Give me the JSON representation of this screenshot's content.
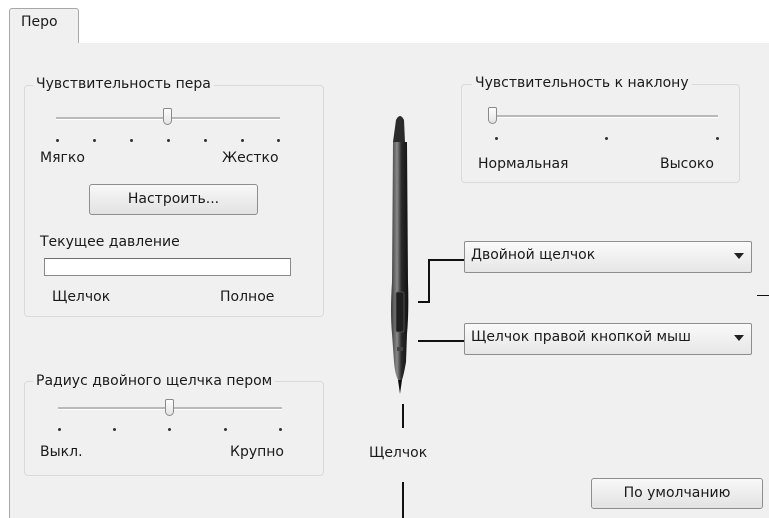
{
  "tab": {
    "label": "Перо"
  },
  "pen_sensitivity": {
    "title": "Чувствительность пера",
    "level": 0.5,
    "min_label": "Мягко",
    "max_label": "Жестко",
    "customize_button": "Настроить...",
    "pressure_title": "Текущее давление",
    "pressure_min_label": "Щелчок",
    "pressure_max_label": "Полное"
  },
  "double_click_radius": {
    "title": "Радиус двойного щелчка пером",
    "level": 0.5,
    "min_label": "Выкл.",
    "max_label": "Крупно"
  },
  "tilt_sensitivity": {
    "title": "Чувствительность к наклону",
    "level": 0.0,
    "min_label": "Нормальная",
    "max_label": "Высоко"
  },
  "pen_buttons": {
    "upper_value": "Двойной щелчок",
    "lower_value": "Щелчок правой кнопкой мыш"
  },
  "tip_label": "Щелчок",
  "default_button": "По умолчанию"
}
